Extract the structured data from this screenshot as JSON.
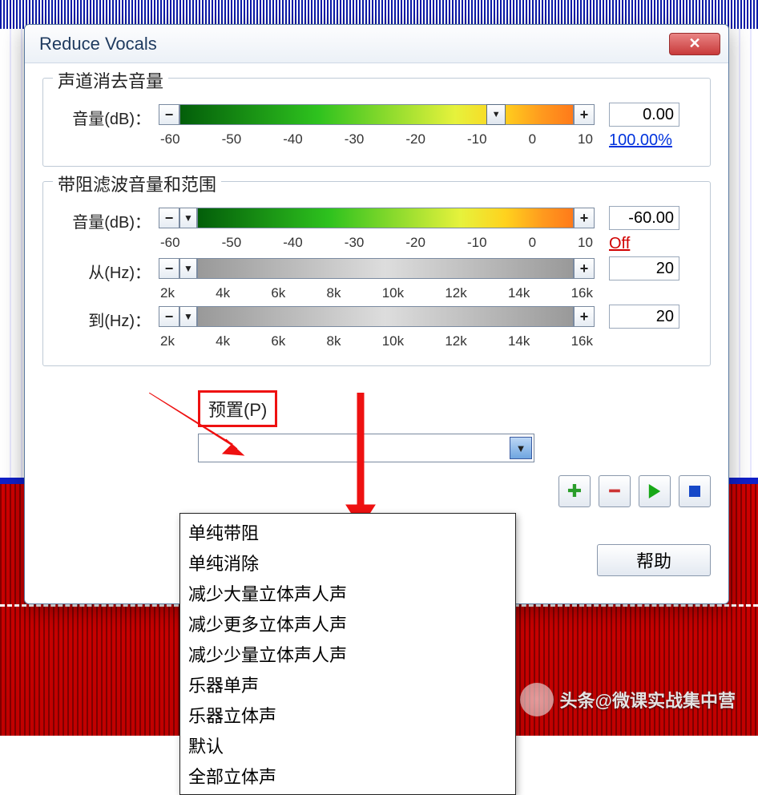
{
  "window": {
    "title": "Reduce Vocals"
  },
  "group1": {
    "title": "声道消去音量",
    "volume": {
      "label": "音量(dB)：",
      "value": "0.00",
      "pct": "100.00%",
      "ticks": [
        "-60",
        "-50",
        "-40",
        "-30",
        "-20",
        "-10",
        "0",
        "10"
      ]
    }
  },
  "group2": {
    "title": "带阻滤波音量和范围",
    "volume": {
      "label": "音量(dB)：",
      "value": "-60.00",
      "off": "Off",
      "ticks": [
        "-60",
        "-50",
        "-40",
        "-30",
        "-20",
        "-10",
        "0",
        "10"
      ]
    },
    "from": {
      "label": "从(Hz)：",
      "value": "20",
      "ticks": [
        "2k",
        "4k",
        "6k",
        "8k",
        "10k",
        "12k",
        "14k",
        "16k"
      ]
    },
    "to": {
      "label": "到(Hz)：",
      "value": "20",
      "ticks": [
        "2k",
        "4k",
        "6k",
        "8k",
        "10k",
        "12k",
        "14k",
        "16k"
      ]
    }
  },
  "preset": {
    "label": "预置(P)",
    "options": [
      "单纯带阻",
      "单纯消除",
      "减少大量立体声人声",
      "减少更多立体声人声",
      "减少少量立体声人声",
      "乐器单声",
      "乐器立体声",
      "默认",
      "全部立体声"
    ]
  },
  "buttons": {
    "help": "帮助"
  },
  "watermark": "头条@微课实战集中营"
}
